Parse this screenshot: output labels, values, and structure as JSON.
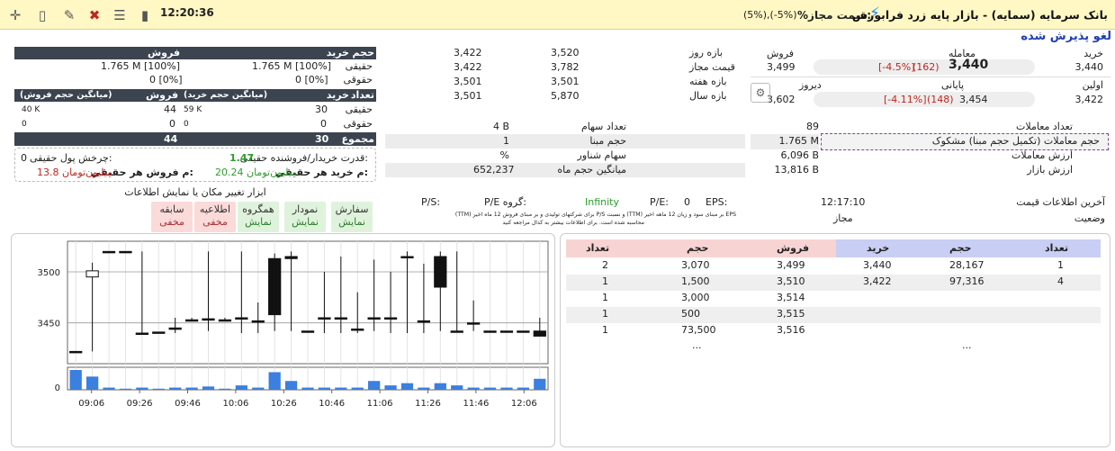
{
  "toolbar": {
    "clock": "12:20:36",
    "title": "بانک سرمایه (سمایه) - بازار پایه زرد فرابورس",
    "price_limit_label": "%قیمت مجاز:",
    "price_limit_value": "(5%),(-5%)"
  },
  "status_heading": "لغو پذیرش شده",
  "prices": {
    "buy_label": "خرید",
    "trade_label": "معامله",
    "sell_label": "فروش",
    "buy_value": "3,440",
    "last_value": "3,440",
    "last_change": "(162)",
    "last_pct": "[-4.5%]",
    "sell_value": "3,499",
    "first_label": "اولین",
    "close_label": "پایانی",
    "yesterday_label": "دیروز",
    "first_value": "3,422",
    "close_value": "3,454",
    "close_change": "(148)",
    "close_pct": "[-4.11%]",
    "yesterday_value": "3,602"
  },
  "ranges": [
    {
      "label": "بازه روز",
      "high": "3,520",
      "low": "3,422"
    },
    {
      "label": "قیمت مجاز",
      "high": "3,782",
      "low": "3,422"
    },
    {
      "label": "بازه هفته",
      "high": "3,501",
      "low": "3,501"
    },
    {
      "label": "بازه سال",
      "high": "5,870",
      "low": "3,501"
    }
  ],
  "traders": {
    "vol_header": "حجم",
    "buy_header": "خرید",
    "sell_header": "فروش",
    "real_label": "حقیقی",
    "legal_label": "حقوقی",
    "real_buy_vol": "1.765 M [100%]",
    "real_sell_vol": "1.765 M [100%]",
    "legal_buy_vol": "0 [0%]",
    "legal_sell_vol": "0 [0%]",
    "count_header": "تعداد",
    "avg_buy_header": "(میانگین حجم خرید)",
    "avg_sell_header": "(میانگین حجم فروش)",
    "real_buy_count": "30",
    "real_buy_avg": "59 K",
    "real_sell_count": "44",
    "real_sell_avg": "40 K",
    "legal_buy_count": "0",
    "legal_buy_avg": "0",
    "legal_sell_count": "0",
    "legal_sell_avg": "0",
    "total_label": "مجموع",
    "total_buy": "30",
    "total_sell": "44",
    "power_label": "قدرت خریدار/فروشنده حقیقی:",
    "power_value": "1.47",
    "money_flow_label": "چرخش پول حقیقی:",
    "money_flow_value": "0",
    "avg_buy_per_label": "م خرید هر حقیقی:",
    "avg_buy_per_value": "20.24 میلیون‌تومان",
    "avg_sell_per_label": "م فروش هر حقیقی:",
    "avg_sell_per_value": "13.8 میلیون‌تومان"
  },
  "stock_info": [
    {
      "label": "تعداد سهام",
      "value": "4 B"
    },
    {
      "label": "حجم مبنا",
      "value": "1"
    },
    {
      "label": "سهام شناور",
      "value": "%"
    },
    {
      "label": "میانگین حجم ماه",
      "value": "652,237"
    }
  ],
  "trade_stats": [
    {
      "label": "تعداد معاملات",
      "value": "89"
    },
    {
      "label": "حجم معاملات (تکمیل حجم مبنا) مشکوک",
      "value": "1.765 M"
    },
    {
      "label": "ارزش معاملات",
      "value": "6,096 B"
    },
    {
      "label": "ارزش بازار",
      "value": "13,816 B"
    }
  ],
  "display_tools": {
    "title": "ابزار تغییر مکان یا نمایش اطلاعات",
    "buttons": [
      {
        "label": "سفارش",
        "state": "نمایش"
      },
      {
        "label": "نمودار",
        "state": "نمایش"
      },
      {
        "label": "همگروه",
        "state": "نمایش"
      },
      {
        "label": "اطلاعیه",
        "state": "مخفی"
      },
      {
        "label": "سابقه",
        "state": "مخفی"
      }
    ]
  },
  "ratios": {
    "eps_label": "EPS:",
    "eps_value": "0",
    "pe_label": "P/E:",
    "pe_value": "Infinity",
    "pe_group_label": "P/E گروه:",
    "ps_label": "P/S:",
    "note1": "EPS بر مبنای سود و زیان 12 ماهه اخیر (TTM) و نسبت P/S برای شرکتهای تولیدی و بر مبنای فروش 12 ماه اخیر (TTM)",
    "note2": "محاسبه شده است. برای اطلاعات بیشتر به کدال مراجعه کنید"
  },
  "last_info": {
    "label": "آخرین اطلاعات قیمت",
    "value": "12:17:10",
    "status_label": "وضعیت",
    "status_value": "مجاز"
  },
  "orderbook": {
    "headers": {
      "count": "تعداد",
      "volume": "حجم",
      "buy": "خرید",
      "sell": "فروش"
    },
    "rows": [
      {
        "buy_count": "1",
        "buy_vol": "28,167",
        "buy_price": "3,440",
        "sell_price": "3,499",
        "sell_vol": "3,070",
        "sell_count": "2"
      },
      {
        "buy_count": "4",
        "buy_vol": "97,316",
        "buy_price": "3,422",
        "sell_price": "3,510",
        "sell_vol": "1,500",
        "sell_count": "1"
      },
      {
        "buy_count": "",
        "buy_vol": "",
        "buy_price": "",
        "sell_price": "3,514",
        "sell_vol": "3,000",
        "sell_count": "1"
      },
      {
        "buy_count": "",
        "buy_vol": "",
        "buy_price": "",
        "sell_price": "3,515",
        "sell_vol": "500",
        "sell_count": "1"
      },
      {
        "buy_count": "",
        "buy_vol": "",
        "buy_price": "",
        "sell_price": "3,516",
        "sell_vol": "73,500",
        "sell_count": "1"
      }
    ],
    "more": "..."
  },
  "colors": {
    "accent_blue": "#1f3fb5",
    "red": "#c0261e",
    "green": "#2e9c2e",
    "dark_header": "#3c4450",
    "buy_header": "#c9cef4",
    "sell_header": "#f8d3d3"
  },
  "chart_data": {
    "type": "candlestick",
    "x_ticks": [
      "09:06",
      "09:26",
      "09:46",
      "10:06",
      "10:26",
      "10:46",
      "11:06",
      "11:26",
      "11:46",
      "12:06"
    ],
    "y_ticks": [
      3500,
      3450
    ],
    "volume_ticks": [
      0
    ],
    "ylim": [
      3410,
      3530
    ],
    "candles": [
      {
        "t": 0,
        "o": 3422,
        "h": 3422,
        "l": 3422,
        "c": 3422,
        "v": 0.9
      },
      {
        "t": 1,
        "o": 3495,
        "h": 3509,
        "l": 3422,
        "c": 3501,
        "v": 0.6
      },
      {
        "t": 2,
        "o": 3520,
        "h": 3520,
        "l": 3520,
        "c": 3520,
        "v": 0.1
      },
      {
        "t": 3,
        "o": 3520,
        "h": 3520,
        "l": 3520,
        "c": 3520,
        "v": 0.05
      },
      {
        "t": 4,
        "o": 3440,
        "h": 3520,
        "l": 3440,
        "c": 3440,
        "v": 0.1
      },
      {
        "t": 5,
        "o": 3441,
        "h": 3441,
        "l": 3441,
        "c": 3441,
        "v": 0.05
      },
      {
        "t": 6,
        "o": 3445,
        "h": 3455,
        "l": 3440,
        "c": 3445,
        "v": 0.1
      },
      {
        "t": 7,
        "o": 3453,
        "h": 3455,
        "l": 3453,
        "c": 3453,
        "v": 0.1
      },
      {
        "t": 8,
        "o": 3454,
        "h": 3520,
        "l": 3442,
        "c": 3454,
        "v": 0.15
      },
      {
        "t": 9,
        "o": 3453,
        "h": 3455,
        "l": 3453,
        "c": 3453,
        "v": 0.05
      },
      {
        "t": 10,
        "o": 3455,
        "h": 3520,
        "l": 3440,
        "c": 3455,
        "v": 0.2
      },
      {
        "t": 11,
        "o": 3452,
        "h": 3470,
        "l": 3440,
        "c": 3452,
        "v": 0.1
      },
      {
        "t": 12,
        "o": 3513,
        "h": 3518,
        "l": 3442,
        "c": 3458,
        "v": 0.8
      },
      {
        "t": 13,
        "o": 3515,
        "h": 3520,
        "l": 3442,
        "c": 3513,
        "v": 0.4
      },
      {
        "t": 14,
        "o": 3442,
        "h": 3442,
        "l": 3442,
        "c": 3442,
        "v": 0.1
      },
      {
        "t": 15,
        "o": 3455,
        "h": 3500,
        "l": 3440,
        "c": 3455,
        "v": 0.1
      },
      {
        "t": 16,
        "o": 3455,
        "h": 3515,
        "l": 3440,
        "c": 3455,
        "v": 0.1
      },
      {
        "t": 17,
        "o": 3444,
        "h": 3480,
        "l": 3440,
        "c": 3444,
        "v": 0.1
      },
      {
        "t": 18,
        "o": 3455,
        "h": 3512,
        "l": 3442,
        "c": 3455,
        "v": 0.4
      },
      {
        "t": 19,
        "o": 3455,
        "h": 3500,
        "l": 3440,
        "c": 3455,
        "v": 0.2
      },
      {
        "t": 20,
        "o": 3515,
        "h": 3520,
        "l": 3440,
        "c": 3515,
        "v": 0.3
      },
      {
        "t": 21,
        "o": 3452,
        "h": 3508,
        "l": 3440,
        "c": 3452,
        "v": 0.1
      },
      {
        "t": 22,
        "o": 3515,
        "h": 3520,
        "l": 3442,
        "c": 3485,
        "v": 0.3
      },
      {
        "t": 23,
        "o": 3442,
        "h": 3520,
        "l": 3442,
        "c": 3442,
        "v": 0.2
      },
      {
        "t": 24,
        "o": 3450,
        "h": 3472,
        "l": 3442,
        "c": 3450,
        "v": 0.1
      },
      {
        "t": 25,
        "o": 3442,
        "h": 3442,
        "l": 3442,
        "c": 3442,
        "v": 0.1
      },
      {
        "t": 26,
        "o": 3442,
        "h": 3442,
        "l": 3442,
        "c": 3442,
        "v": 0.1
      },
      {
        "t": 27,
        "o": 3442,
        "h": 3442,
        "l": 3442,
        "c": 3442,
        "v": 0.1
      },
      {
        "t": 28,
        "o": 3442,
        "h": 3455,
        "l": 3440,
        "c": 3437,
        "v": 0.5
      }
    ]
  }
}
